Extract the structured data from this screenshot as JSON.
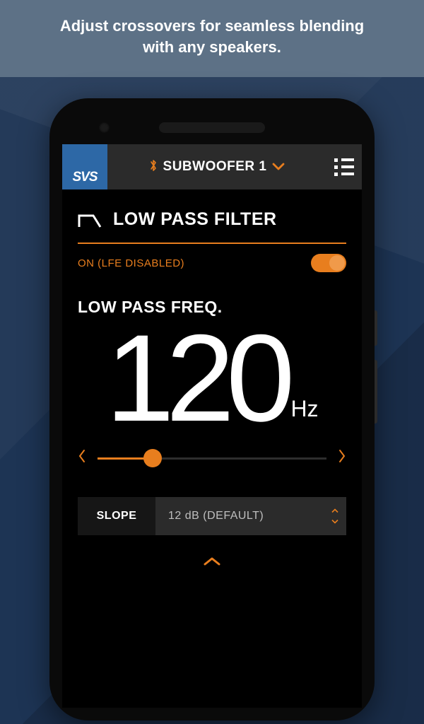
{
  "banner": {
    "text": "Adjust crossovers for seamless blending with any speakers."
  },
  "header": {
    "logo_text": "SVS",
    "device_label": "SUBWOOFER 1"
  },
  "filter": {
    "section_title": "LOW PASS FILTER",
    "toggle_label": "ON (LFE DISABLED)",
    "toggle_on": true,
    "freq_label": "LOW PASS FREQ.",
    "freq_value": "120",
    "freq_unit": "Hz",
    "slider_percent": 24
  },
  "slope": {
    "label": "SLOPE",
    "value": "12 dB (DEFAULT)"
  },
  "colors": {
    "accent": "#e87e1e",
    "header_bg": "#2b2b2b",
    "banner_bg": "#5d7186",
    "page_bg": "#1d3454",
    "logo_bg": "#2d68a6"
  }
}
